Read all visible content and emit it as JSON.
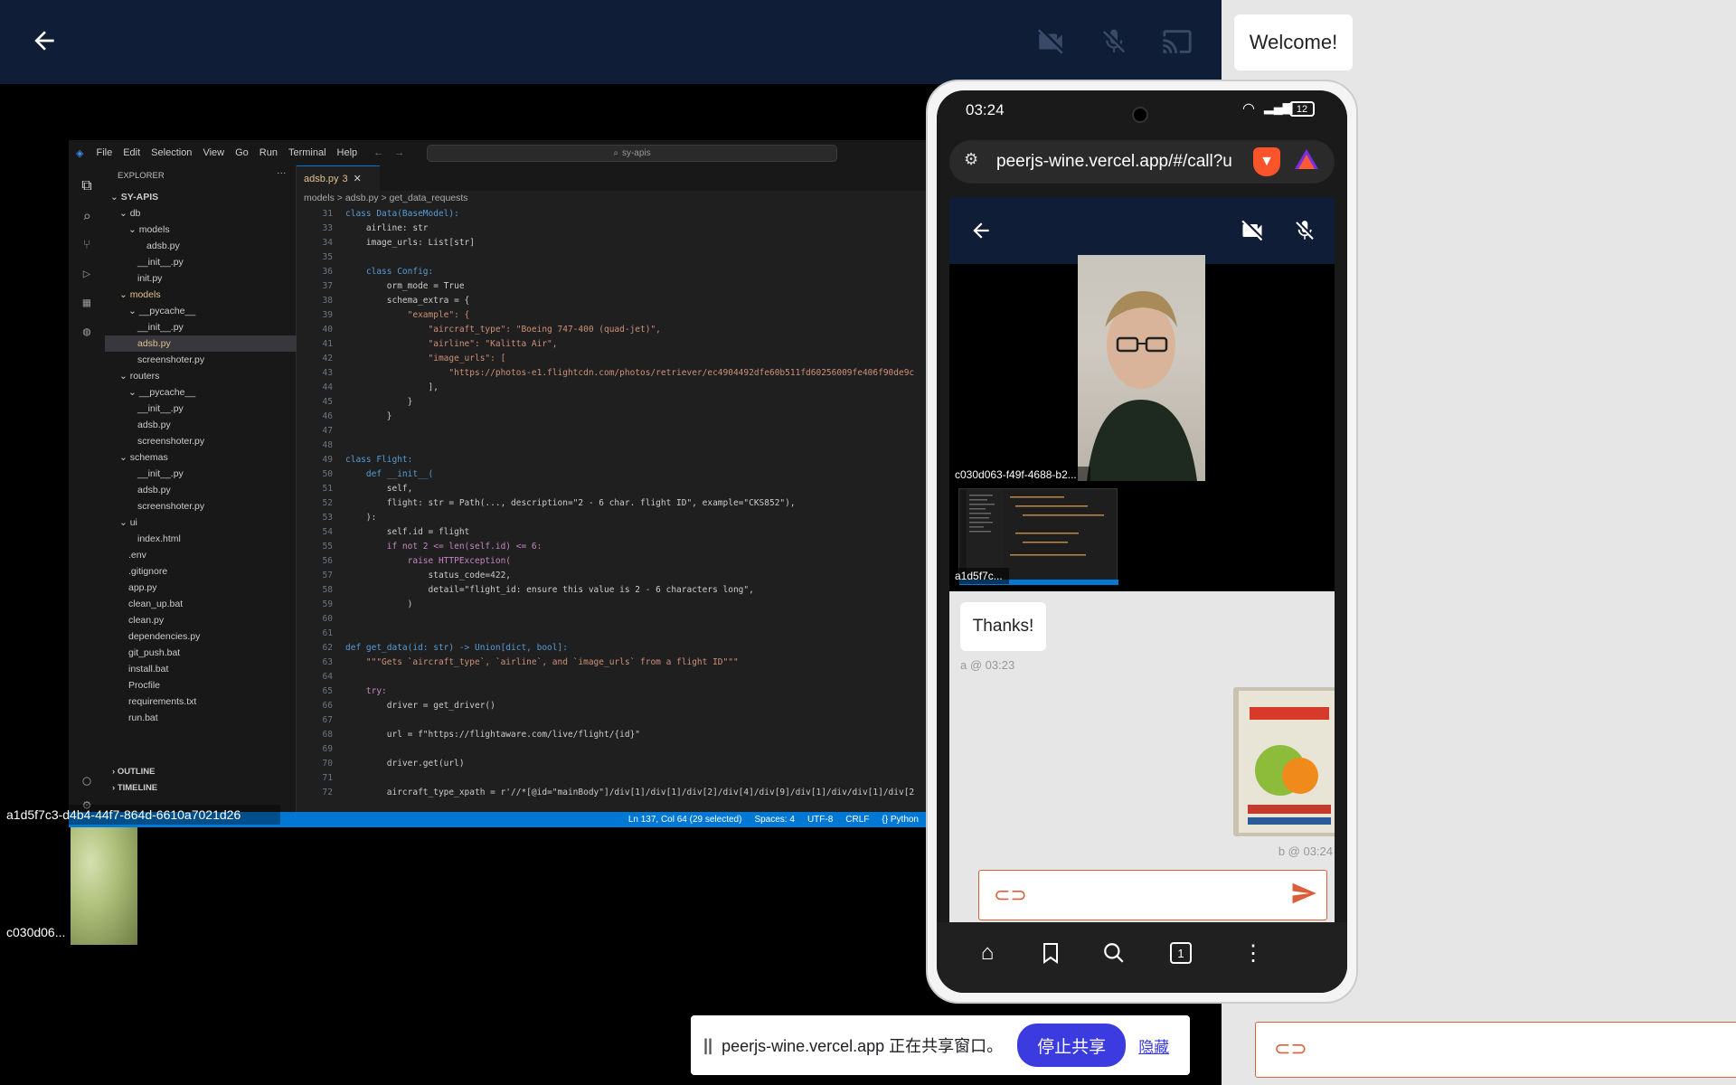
{
  "top_bar": {
    "icons": [
      "back-arrow-icon",
      "camera-off-icon",
      "mic-off-icon",
      "cast-icon"
    ],
    "welcome_text": "Welcome!"
  },
  "vscode": {
    "menu": [
      "File",
      "Edit",
      "Selection",
      "View",
      "Go",
      "Run",
      "Terminal",
      "Help"
    ],
    "search": "sy-apis",
    "explorer_title": "EXPLORER",
    "tree": [
      {
        "label": "SY-APIS",
        "indent": 0,
        "kind": "root"
      },
      {
        "label": "db",
        "indent": 1,
        "kind": "folder"
      },
      {
        "label": "models",
        "indent": 2,
        "kind": "folder"
      },
      {
        "label": "adsb.py",
        "indent": 4,
        "kind": "file"
      },
      {
        "label": "__init__.py",
        "indent": 3,
        "kind": "file"
      },
      {
        "label": "init.py",
        "indent": 3,
        "kind": "file"
      },
      {
        "label": "models",
        "indent": 1,
        "kind": "folder-mod"
      },
      {
        "label": "__pycache__",
        "indent": 2,
        "kind": "folder"
      },
      {
        "label": "__init__.py",
        "indent": 3,
        "kind": "file"
      },
      {
        "label": "adsb.py",
        "indent": 3,
        "kind": "file-sel"
      },
      {
        "label": "screenshoter.py",
        "indent": 3,
        "kind": "file"
      },
      {
        "label": "routers",
        "indent": 1,
        "kind": "folder"
      },
      {
        "label": "__pycache__",
        "indent": 2,
        "kind": "folder"
      },
      {
        "label": "__init__.py",
        "indent": 3,
        "kind": "file"
      },
      {
        "label": "adsb.py",
        "indent": 3,
        "kind": "file"
      },
      {
        "label": "screenshoter.py",
        "indent": 3,
        "kind": "file"
      },
      {
        "label": "schemas",
        "indent": 1,
        "kind": "folder"
      },
      {
        "label": "__init__.py",
        "indent": 3,
        "kind": "file"
      },
      {
        "label": "adsb.py",
        "indent": 3,
        "kind": "file"
      },
      {
        "label": "screenshoter.py",
        "indent": 3,
        "kind": "file"
      },
      {
        "label": "ui",
        "indent": 1,
        "kind": "folder"
      },
      {
        "label": "index.html",
        "indent": 3,
        "kind": "file"
      },
      {
        "label": ".env",
        "indent": 2,
        "kind": "file"
      },
      {
        "label": ".gitignore",
        "indent": 2,
        "kind": "file"
      },
      {
        "label": "app.py",
        "indent": 2,
        "kind": "file"
      },
      {
        "label": "clean_up.bat",
        "indent": 2,
        "kind": "file"
      },
      {
        "label": "clean.py",
        "indent": 2,
        "kind": "file"
      },
      {
        "label": "dependencies.py",
        "indent": 2,
        "kind": "file"
      },
      {
        "label": "git_push.bat",
        "indent": 2,
        "kind": "file"
      },
      {
        "label": "install.bat",
        "indent": 2,
        "kind": "file"
      },
      {
        "label": "Procfile",
        "indent": 2,
        "kind": "file"
      },
      {
        "label": "requirements.txt",
        "indent": 2,
        "kind": "file"
      },
      {
        "label": "run.bat",
        "indent": 2,
        "kind": "file"
      }
    ],
    "outline_label": "OUTLINE",
    "timeline_label": "TIMELINE",
    "tab_label": "adsb.py",
    "tab_badge": "3",
    "breadcrumb": "models > adsb.py > get_data_requests",
    "code_lines": [
      {
        "n": "31",
        "t": "class Data(BaseModel):"
      },
      {
        "n": "33",
        "t": "    airline: str"
      },
      {
        "n": "34",
        "t": "    image_urls: List[str]"
      },
      {
        "n": "35",
        "t": ""
      },
      {
        "n": "36",
        "t": "    class Config:"
      },
      {
        "n": "37",
        "t": "        orm_mode = True"
      },
      {
        "n": "38",
        "t": "        schema_extra = {"
      },
      {
        "n": "39",
        "t": "            \"example\": {"
      },
      {
        "n": "40",
        "t": "                \"aircraft_type\": \"Boeing 747-400 (quad-jet)\","
      },
      {
        "n": "41",
        "t": "                \"airline\": \"Kalitta Air\","
      },
      {
        "n": "42",
        "t": "                \"image_urls\": ["
      },
      {
        "n": "43",
        "t": "                    \"https://photos-e1.flightcdn.com/photos/retriever/ec4904492dfe60b511fd60256009fe406f90de9c"
      },
      {
        "n": "44",
        "t": "                ],"
      },
      {
        "n": "45",
        "t": "            }"
      },
      {
        "n": "46",
        "t": "        }"
      },
      {
        "n": "47",
        "t": ""
      },
      {
        "n": "48",
        "t": ""
      },
      {
        "n": "49",
        "t": "class Flight:"
      },
      {
        "n": "50",
        "t": "    def __init__("
      },
      {
        "n": "51",
        "t": "        self,"
      },
      {
        "n": "52",
        "t": "        flight: str = Path(..., description=\"2 - 6 char. flight ID\", example=\"CKS852\"),"
      },
      {
        "n": "53",
        "t": "    ):"
      },
      {
        "n": "54",
        "t": "        self.id = flight"
      },
      {
        "n": "55",
        "t": "        if not 2 <= len(self.id) <= 6:"
      },
      {
        "n": "56",
        "t": "            raise HTTPException("
      },
      {
        "n": "57",
        "t": "                status_code=422,"
      },
      {
        "n": "58",
        "t": "                detail=\"flight_id: ensure this value is 2 - 6 characters long\","
      },
      {
        "n": "59",
        "t": "            )"
      },
      {
        "n": "60",
        "t": ""
      },
      {
        "n": "61",
        "t": ""
      },
      {
        "n": "62",
        "t": "def get_data(id: str) -> Union[dict, bool]:"
      },
      {
        "n": "63",
        "t": "    \"\"\"Gets `aircraft_type`, `airline`, and `image_urls` from a flight ID\"\"\""
      },
      {
        "n": "64",
        "t": ""
      },
      {
        "n": "65",
        "t": "    try:"
      },
      {
        "n": "66",
        "t": "        driver = get_driver()"
      },
      {
        "n": "67",
        "t": ""
      },
      {
        "n": "68",
        "t": "        url = f\"https://flightaware.com/live/flight/{id}\""
      },
      {
        "n": "69",
        "t": ""
      },
      {
        "n": "70",
        "t": "        driver.get(url)"
      },
      {
        "n": "71",
        "t": ""
      },
      {
        "n": "72",
        "t": "        aircraft_type_xpath = r'//*[@id=\"mainBody\"]/div[1]/div[1]/div[2]/div[4]/div[9]/div[1]/div/div[1]/div[2"
      }
    ],
    "status_items": [
      "Ln 137, Col 64 (29 selected)",
      "Spaces: 4",
      "UTF-8",
      "CRLF",
      "{} Python"
    ]
  },
  "remote_peer_label": "a1d5f7c3-d4b4-44f7-864d-6610a7021d26",
  "local_peer_label": "c030d06...",
  "phone": {
    "time": "03:24",
    "battery": "12",
    "url": "peerjs-wine.vercel.app/#/call?u",
    "video_label_1": "c030d063-f49f-4688-b2...",
    "video_label_2": "a1d5f7c...",
    "chat": [
      {
        "text": "Thanks!",
        "meta": "a @ 03:23"
      },
      {
        "image": "book-cover-freakonomics",
        "meta": "b @ 03:24"
      }
    ],
    "tab_count": "1"
  },
  "share_bar": {
    "pause_glyph": "||",
    "text": "peerjs-wine.vercel.app 正在共享窗口。",
    "stop_label": "停止共享",
    "hide_label": "隐藏"
  },
  "colors": {
    "navy": "#0f1d37",
    "accent_orange": "#d9603b",
    "share_blue": "#3b3be0"
  }
}
